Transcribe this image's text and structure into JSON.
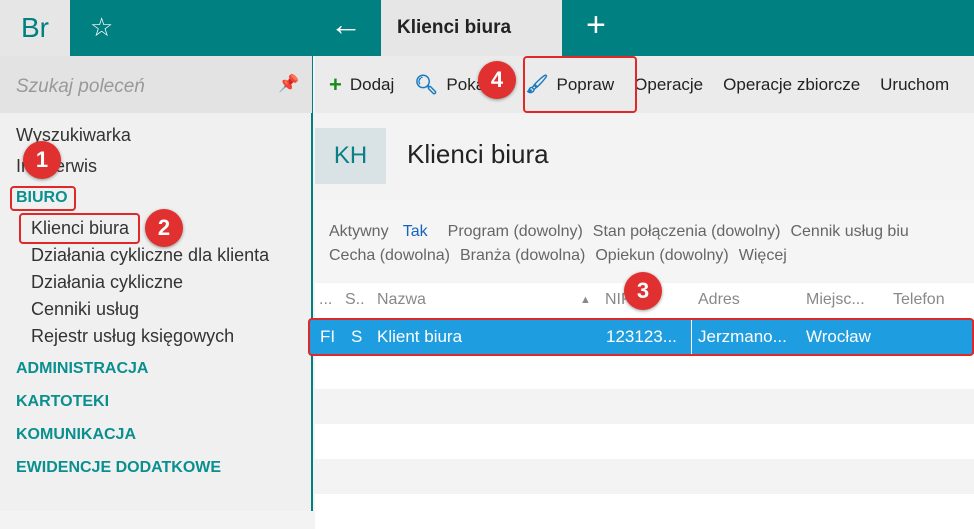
{
  "topbar": {
    "logo": "Br",
    "tab_title": "Klienci biura"
  },
  "sidebar": {
    "search_placeholder": "Szukaj poleceń",
    "items": [
      "Wyszukiwarka",
      "Infoserwis"
    ],
    "groups": [
      "BIURO",
      "ADMINISTRACJA",
      "KARTOTEKI",
      "KOMUNIKACJA",
      "EWIDENCJE DODATKOWE"
    ],
    "biuro_items": [
      "Klienci biura",
      "Działania cykliczne dla klienta",
      "Działania cykliczne",
      "Cenniki usług",
      "Rejestr usług księgowych"
    ]
  },
  "toolbar": {
    "add": "Dodaj",
    "show": "Pokaż",
    "edit": "Popraw",
    "operations": "Operacje",
    "bulk_operations": "Operacje zbiorcze",
    "run": "Uruchom"
  },
  "header": {
    "badge": "KH",
    "title": "Klienci biura"
  },
  "filters": {
    "active_label": "Aktywny",
    "active_value": "Tak",
    "program": "Program (dowolny)",
    "connection": "Stan połączenia (dowolny)",
    "pricelist": "Cennik usług biu",
    "feature": "Cecha (dowolna)",
    "industry": "Branża (dowolna)",
    "keeper": "Opiekun (dowolny)",
    "more": "Więcej"
  },
  "grid": {
    "columns": [
      "...",
      "S..",
      "Nazwa",
      "NIP",
      "Adres",
      "Miejsc...",
      "Telefon"
    ],
    "rows": [
      {
        "c0": "FI",
        "c1": "S",
        "name": "Klient biura",
        "nip": "123123...",
        "address": "Jerzmano...",
        "city": "Wrocław",
        "phone": ""
      }
    ]
  },
  "annotations": [
    "1",
    "2",
    "3",
    "4"
  ],
  "colors": {
    "teal": "#008080",
    "selection": "#1e9de0",
    "annotation": "#e03030"
  }
}
